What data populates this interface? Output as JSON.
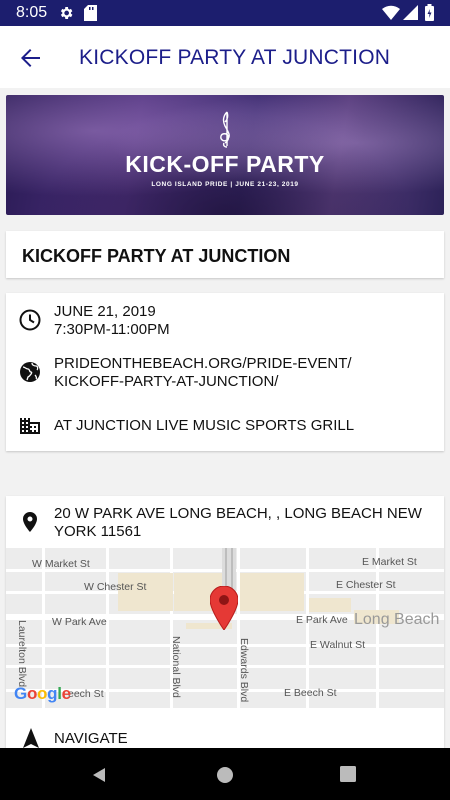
{
  "status_bar": {
    "time": "8:05",
    "icons": [
      "gear-icon",
      "sd-card-icon",
      "wifi-icon",
      "signal-icon",
      "battery-icon"
    ]
  },
  "app_bar": {
    "title": "KICKOFF PARTY AT JUNCTION",
    "back_icon": "arrow-back-icon"
  },
  "banner": {
    "title": "KICK-OFF PARTY",
    "subtitle": "LONG ISLAND PRIDE | JUNE 21-23, 2019"
  },
  "event": {
    "title": "KICKOFF PARTY AT JUNCTION",
    "date": "JUNE 21, 2019",
    "time": "7:30PM-11:00PM",
    "url_line1": "PRIDEONTHEBEACH.ORG/PRIDE-EVENT/",
    "url_line2": "KICKOFF-PARTY-AT-JUNCTION/",
    "venue": "AT JUNCTION LIVE MUSIC SPORTS GRILL"
  },
  "location": {
    "address": "20 W PARK AVE  LONG BEACH, , LONG BEACH NEW YORK 11561",
    "navigate_label": "NAVIGATE"
  },
  "map": {
    "streets": {
      "w_market": "W Market St",
      "e_market": "E Market St",
      "w_chester": "W Chester St",
      "e_chester": "E Chester St",
      "w_park": "W Park Ave",
      "e_park": "E Park Ave",
      "e_walnut": "E Walnut St",
      "w_beech": "eech St",
      "e_beech": "E Beech St",
      "laurelton": "Laurelton Blvd",
      "national": "National Blvd",
      "edwards": "Edwards Blvd"
    },
    "city": "Long Beach",
    "attribution": "Google",
    "marker_color": "#e53935"
  },
  "colors": {
    "primary": "#1c1e8a",
    "status_bar": "#1c1e6e"
  }
}
